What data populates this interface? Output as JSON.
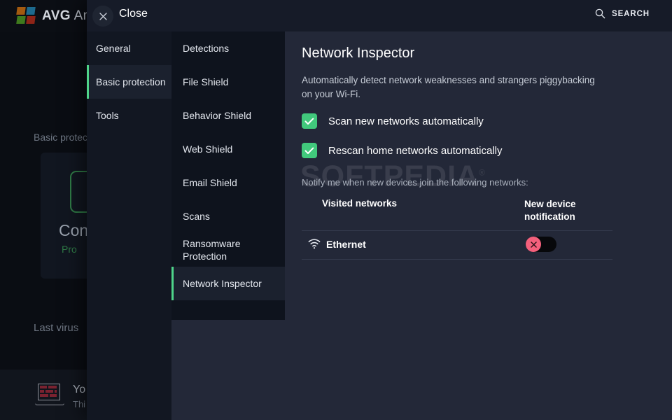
{
  "background_app": {
    "brand": "AVG",
    "brand_suffix": " An",
    "logo_icon": "avg-pinwheel-logo",
    "section_label": "Basic protect",
    "card_icon": "shield-computer-icon",
    "card_title": "Con",
    "card_status": "Pro",
    "last_virus_label": "Last virus",
    "bottom_icon": "laptop-firewall-icon",
    "bottom_title": "Yo",
    "bottom_sub": "Thi"
  },
  "overlay": {
    "header": {
      "close_icon": "close-icon",
      "close_label": "Close",
      "search_icon": "search-icon",
      "search_label": "SEARCH"
    },
    "nav": {
      "items": [
        {
          "label": "General",
          "active": false
        },
        {
          "label": "Basic protection",
          "active": true
        },
        {
          "label": "Tools",
          "active": false
        }
      ]
    },
    "submenu": {
      "items": [
        {
          "label": "Detections",
          "active": false
        },
        {
          "label": "File Shield",
          "active": false
        },
        {
          "label": "Behavior Shield",
          "active": false
        },
        {
          "label": "Web Shield",
          "active": false
        },
        {
          "label": "Email Shield",
          "active": false
        },
        {
          "label": "Scans",
          "active": false
        },
        {
          "label": "Ransomware Protection",
          "active": false
        },
        {
          "label": "Network Inspector",
          "active": true
        }
      ]
    },
    "main": {
      "watermark": "SOFTPEDIA",
      "title": "Network Inspector",
      "description": "Automatically detect network weaknesses and strangers piggybacking on your Wi-Fi.",
      "checkboxes": [
        {
          "label": "Scan new networks automatically",
          "checked": true,
          "icon": "checkmark-icon"
        },
        {
          "label": "Rescan home networks automatically",
          "checked": true,
          "icon": "checkmark-icon"
        }
      ],
      "notify_text": "Notify me when new devices join the following networks:",
      "table": {
        "columns": [
          "Visited networks",
          "New device notification"
        ],
        "rows": [
          {
            "icon": "wifi-icon",
            "name": "Ethernet",
            "notification_enabled": false,
            "toggle_icon": "cross-icon"
          }
        ]
      }
    }
  },
  "colors": {
    "accent_green": "#4fd48a",
    "checkbox_green": "#41c97c",
    "toggle_off_red": "#f4607c",
    "panel_bg": "#232838",
    "nav_bg": "#121722",
    "submenu_bg": "#0e131d",
    "header_bg": "#161b28"
  }
}
